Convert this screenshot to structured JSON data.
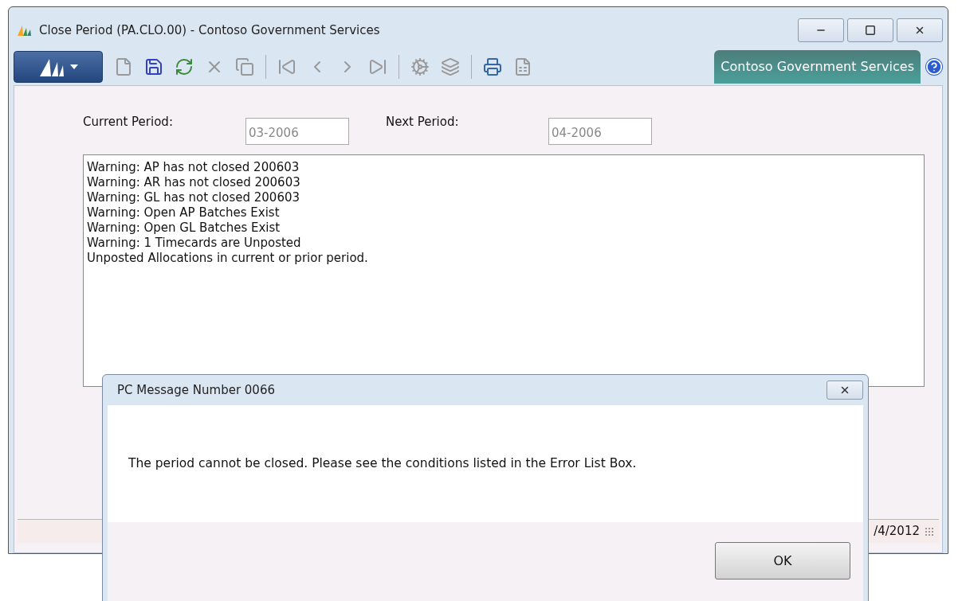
{
  "window": {
    "title": "Close Period (PA.CLO.00) - Contoso Government Services"
  },
  "toolbar": {
    "company": "Contoso Government Services"
  },
  "form": {
    "fields": [
      {
        "label": "Current Period:",
        "value": "03-2006"
      },
      {
        "label": "Next Period:",
        "value": "04-2006"
      }
    ],
    "error_list": [
      "Warning: AP has not closed 200603",
      "Warning: AR has not closed 200603",
      "Warning: GL has not closed 200603",
      "Warning: Open AP Batches Exist",
      "Warning: Open GL Batches Exist",
      "Warning: 1 Timecards are Unposted",
      "Unposted Allocations in current or prior period."
    ]
  },
  "status_bar": {
    "date": "/4/2012"
  },
  "dialog": {
    "title": "PC Message Number 0066",
    "message": "The period cannot be closed. Please see the conditions listed in the Error List Box.",
    "buttons": [
      "OK"
    ]
  }
}
